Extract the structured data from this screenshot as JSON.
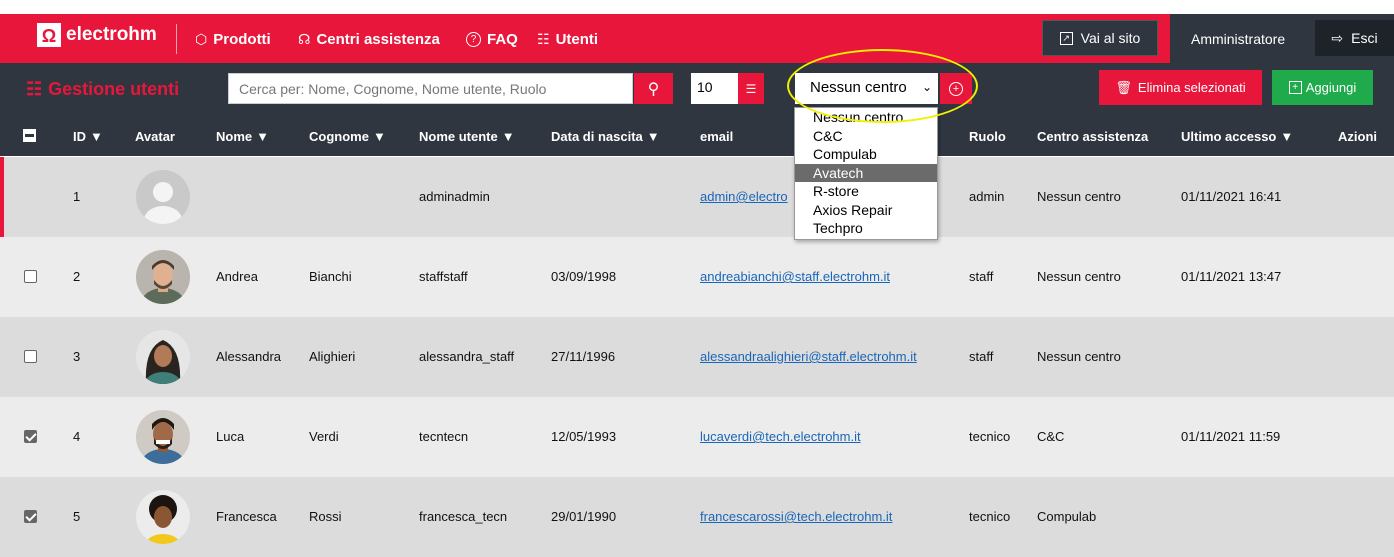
{
  "brand": {
    "name": "electrohm"
  },
  "nav": [
    {
      "icon": "cube-icon",
      "glyph": "⬡",
      "label": "Prodotti"
    },
    {
      "icon": "headset-icon",
      "glyph": "☊",
      "label": "Centri assistenza"
    },
    {
      "icon": "question-icon",
      "glyph": "?",
      "label": "FAQ"
    },
    {
      "icon": "users-icon",
      "glyph": "☷",
      "label": "Utenti"
    }
  ],
  "header": {
    "site_label": "Vai al sito",
    "user_label": "Amministratore",
    "logout_label": "Esci"
  },
  "toolbar": {
    "title": "Gestione utenti",
    "search_placeholder": "Cerca per: Nome, Cognome, Nome utente, Ruolo",
    "per_page": "10",
    "center_select": "Nessun centro",
    "delete_label": "Elimina selezionati",
    "add_label": "Aggiungi"
  },
  "columns": {
    "id": "ID",
    "avatar": "Avatar",
    "nome": "Nome",
    "cognome": "Cognome",
    "username": "Nome utente",
    "birth": "Data di nascita",
    "email": "email",
    "ruolo": "Ruolo",
    "centro": "Centro assistenza",
    "accesso": "Ultimo accesso",
    "azioni": "Azioni"
  },
  "rows": [
    {
      "id": "1",
      "nome": "",
      "cognome": "",
      "username": "adminadmin",
      "birth": "",
      "email": "admin@electro",
      "ruolo": "admin",
      "centro": "Nessun centro",
      "accesso": "01/11/2021 16:41",
      "checked": false
    },
    {
      "id": "2",
      "nome": "Andrea",
      "cognome": "Bianchi",
      "username": "staffstaff",
      "birth": "03/09/1998",
      "email": "andreabianchi@staff.electrohm.it",
      "ruolo": "staff",
      "centro": "Nessun centro",
      "accesso": "01/11/2021 13:47",
      "checked": false
    },
    {
      "id": "3",
      "nome": "Alessandra",
      "cognome": "Alighieri",
      "username": "alessandra_staff",
      "birth": "27/11/1996",
      "email": "alessandraalighieri@staff.electrohm.it",
      "ruolo": "staff",
      "centro": "Nessun centro",
      "accesso": "",
      "checked": false
    },
    {
      "id": "4",
      "nome": "Luca",
      "cognome": "Verdi",
      "username": "tecntecn",
      "birth": "12/05/1993",
      "email": "lucaverdi@tech.electrohm.it",
      "ruolo": "tecnico",
      "centro": "C&C",
      "accesso": "01/11/2021 11:59",
      "checked": true
    },
    {
      "id": "5",
      "nome": "Francesca",
      "cognome": "Rossi",
      "username": "francesca_tecn",
      "birth": "29/01/1990",
      "email": "francescarossi@tech.electrohm.it",
      "ruolo": "tecnico",
      "centro": "Compulab",
      "accesso": "",
      "checked": true
    }
  ],
  "dropdown_options": [
    "Nessun centro",
    "C&C",
    "Compulab",
    "Avatech",
    "R-store",
    "Axios Repair",
    "Techpro"
  ],
  "dropdown_highlighted": "Avatech",
  "colors": {
    "brand_red": "#e8163a",
    "dark": "#2f3640",
    "green": "#1faa4b",
    "row_gray": "#dcdcdc",
    "row_light": "#ececec"
  }
}
